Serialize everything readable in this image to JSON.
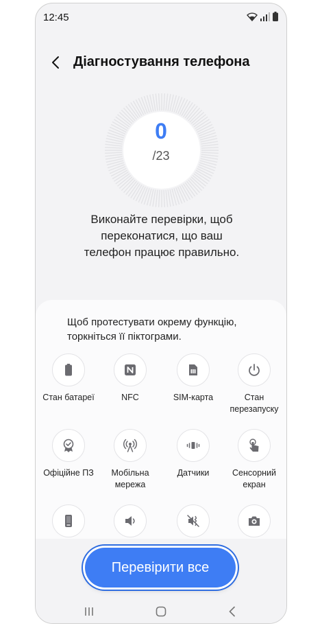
{
  "status_bar": {
    "time": "12:45"
  },
  "header": {
    "title": "Діагностування телефона"
  },
  "progress": {
    "completed": "0",
    "total_label": "/23",
    "fraction": 0.0
  },
  "intro_text": "Виконайте перевірки, щоб переконатися, що ваш телефон працює правильно.",
  "hint_text": "Щоб протестувати окрему функцію, торкніться її піктограми.",
  "tests": [
    {
      "label": "Стан батареї",
      "icon": "battery-icon"
    },
    {
      "label": "NFC",
      "icon": "nfc-icon"
    },
    {
      "label": "SIM-карта",
      "icon": "sim-card-icon"
    },
    {
      "label": "Стан перезапуску",
      "icon": "restart-icon"
    },
    {
      "label": "Офіційне ПЗ",
      "icon": "official-software-icon"
    },
    {
      "label": "Мобільна мережа",
      "icon": "mobile-network-icon"
    },
    {
      "label": "Датчики",
      "icon": "sensors-icon"
    },
    {
      "label": "Сенсорний екран",
      "icon": "touch-screen-icon"
    },
    {
      "label": "",
      "icon": "phone-icon"
    },
    {
      "label": "",
      "icon": "speaker-icon"
    },
    {
      "label": "",
      "icon": "vibration-mute-icon"
    },
    {
      "label": "",
      "icon": "camera-icon"
    }
  ],
  "actions": {
    "check_all_label": "Перевірити все"
  },
  "colors": {
    "accent": "#3e7df4",
    "background": "#f3f3f5",
    "icon_gray": "#6b6b70"
  }
}
